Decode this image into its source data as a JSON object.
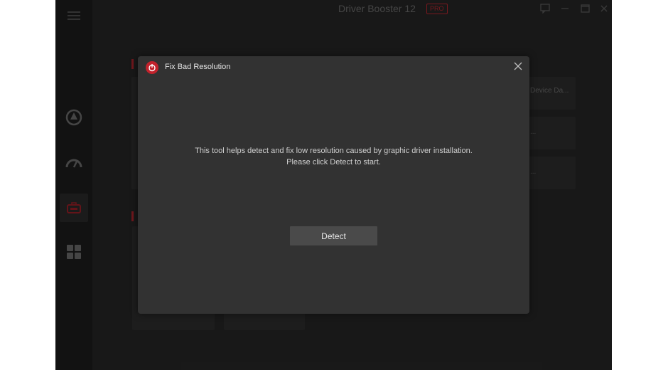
{
  "app": {
    "title": "Driver Booster 12",
    "badge": "PRO"
  },
  "background": {
    "tile_labels": [
      "Device Da...",
      "...",
      "..."
    ]
  },
  "sidebar": {
    "items": [
      {
        "name": "menu",
        "icon": "hamburger-icon"
      },
      {
        "name": "scan",
        "icon": "scan-circle-icon"
      },
      {
        "name": "boost",
        "icon": "speedometer-icon"
      },
      {
        "name": "toolbox",
        "icon": "toolbox-icon",
        "active": true
      },
      {
        "name": "action-center",
        "icon": "grid-icon"
      }
    ]
  },
  "dialog": {
    "title": "Fix Bad Resolution",
    "message_line1": "This tool helps detect and fix low resolution caused by graphic driver installation.",
    "message_line2": "Please click Detect to start.",
    "detect_label": "Detect"
  },
  "colors": {
    "accent": "#c2222c",
    "dialog_bg": "#323232",
    "button_bg": "#4a4a4a"
  }
}
